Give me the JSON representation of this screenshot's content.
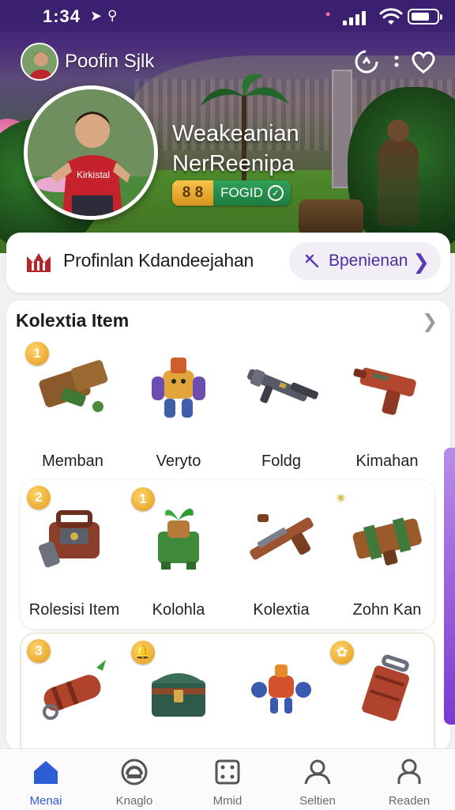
{
  "status_bar": {
    "time": "1:34"
  },
  "header": {
    "username": "Poofin Sjlk"
  },
  "profile": {
    "title_line1": "Weakeanian",
    "title_line2": "NerReenipa",
    "badge_number": "8 8",
    "badge_text": "FOGID"
  },
  "info_card": {
    "title": "Profinlan Kdandeejahan",
    "action_label": "Bpenienan"
  },
  "collection": {
    "title": "Kolextia Item",
    "row1": [
      {
        "label": "Memban",
        "rank": "1",
        "icon": "cannon-icon"
      },
      {
        "label": "Veryto",
        "rank": "",
        "icon": "robot-icon"
      },
      {
        "label": "Foldg",
        "rank": "",
        "icon": "rifle-icon"
      },
      {
        "label": "Kimahan",
        "rank": "",
        "icon": "blaster-icon"
      }
    ],
    "row2": [
      {
        "label": "Rolesisi Item",
        "rank": "2",
        "icon": "toolbox-icon"
      },
      {
        "label": "Kolohla",
        "rank": "1",
        "icon": "plant-bot-icon"
      },
      {
        "label": "Kolextia",
        "rank": "",
        "icon": "shotgun-icon"
      },
      {
        "label": "Zohn Kan",
        "rank": "",
        "icon": "launcher-icon"
      }
    ],
    "row3": [
      {
        "label": "",
        "rank": "3",
        "icon": "carrot-bomb-icon"
      },
      {
        "label": "",
        "rank": "",
        "icon": "chest-icon"
      },
      {
        "label": "",
        "rank": "",
        "icon": "mini-robot-icon"
      },
      {
        "label": "",
        "rank": "",
        "icon": "cart-icon"
      }
    ]
  },
  "bottom_nav": {
    "items": [
      {
        "label": "Menai",
        "icon": "home-icon",
        "active": true
      },
      {
        "label": "Knaglo",
        "icon": "badge-icon",
        "active": false
      },
      {
        "label": "Mmid",
        "icon": "dice-icon",
        "active": false
      },
      {
        "label": "Seltien",
        "icon": "person-icon",
        "active": false
      },
      {
        "label": "Readen",
        "icon": "profile-icon",
        "active": false
      }
    ]
  },
  "colors": {
    "accent": "#2c5dd6",
    "brand_purple": "#4b2da0",
    "gold": "#e29a1a",
    "green": "#1e7a3f"
  }
}
